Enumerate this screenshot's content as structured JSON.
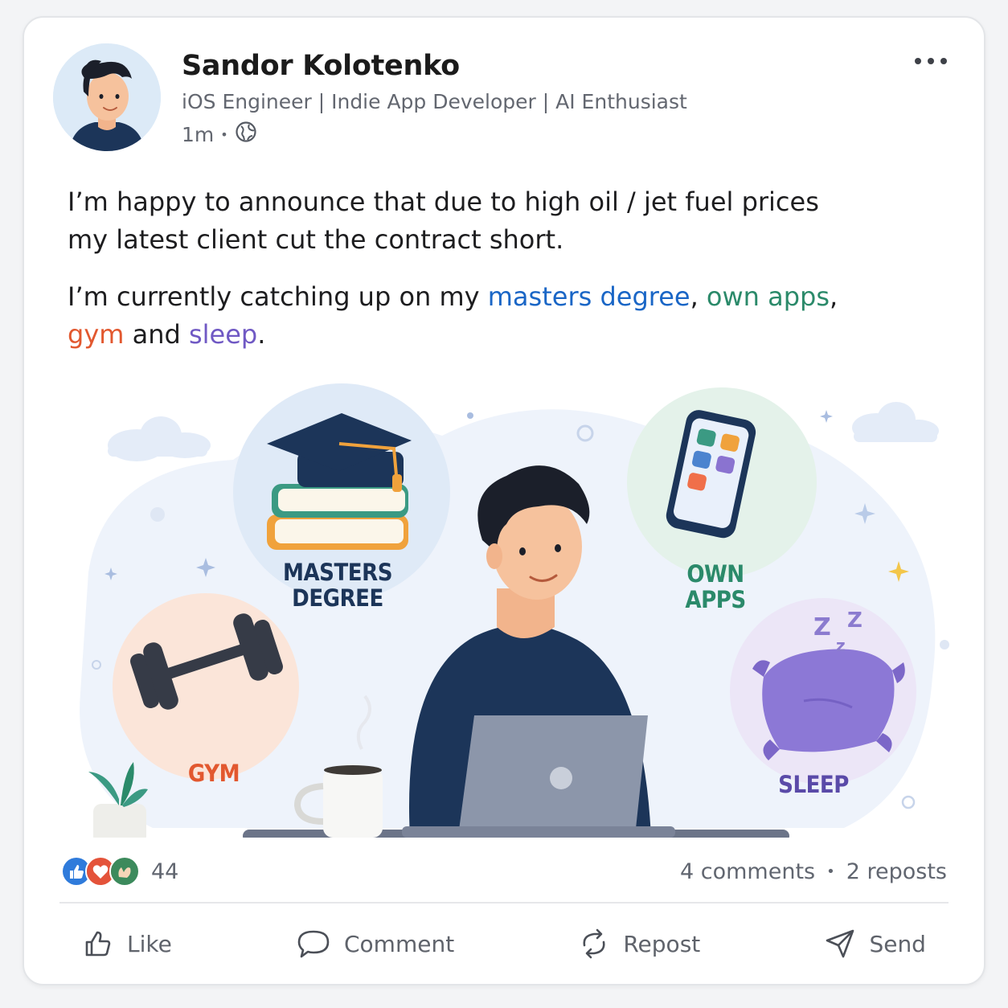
{
  "post": {
    "author": "Sandor Kolotenko",
    "headline": "iOS Engineer | Indie App Developer | AI Enthusiast",
    "time": "1m",
    "separator": "•",
    "visibility_icon": "globe-icon",
    "more_icon": "more-horizontal-icon",
    "paragraph1_line1": "I’m happy to announce that due to high oil / jet fuel prices",
    "paragraph1_line2": "my latest client cut the contract short.",
    "paragraph2": {
      "prefix": "I’m currently catching up on my ",
      "item1": "masters degree",
      "comma1": ", ",
      "item2": "own apps",
      "comma2": ",",
      "item3": "gym",
      "and": " and ",
      "item4": "sleep",
      "end": "."
    }
  },
  "illustration": {
    "label_masters_1": "MASTERS",
    "label_masters_2": "DEGREE",
    "label_apps_1": "OWN",
    "label_apps_2": "APPS",
    "label_gym": "GYM",
    "label_sleep": "SLEEP",
    "zzz": "Z",
    "colors": {
      "blue": "#1a66c6",
      "green": "#2b8a6a",
      "orange": "#e2582f",
      "purple": "#7059c4",
      "navy": "#1c3559"
    }
  },
  "stats": {
    "reaction_icons": [
      "like-reaction-icon",
      "love-reaction-icon",
      "celebrate-reaction-icon"
    ],
    "reaction_count": "44",
    "comments": "4 comments",
    "dot": "•",
    "reposts": "2 reposts"
  },
  "actions": {
    "like": "Like",
    "comment": "Comment",
    "repost": "Repost",
    "send": "Send"
  }
}
